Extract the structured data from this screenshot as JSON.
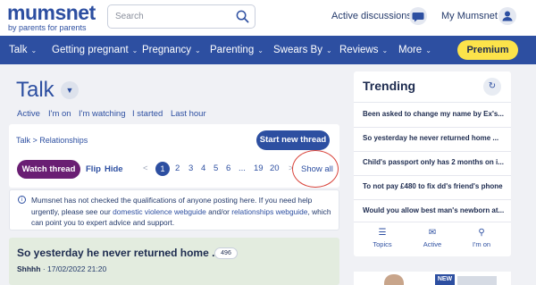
{
  "header": {
    "logo_main": "mumsnet",
    "logo_tagline": "by parents for parents",
    "search_placeholder": "Search",
    "active_discussions": "Active discussions",
    "my_mumsnet": "My Mumsnet"
  },
  "nav": {
    "items": [
      {
        "label": "Talk"
      },
      {
        "label": "Getting pregnant"
      },
      {
        "label": "Pregnancy"
      },
      {
        "label": "Parenting"
      },
      {
        "label": "Swears By"
      },
      {
        "label": "Reviews"
      },
      {
        "label": "More"
      }
    ],
    "premium": "Premium"
  },
  "talk": {
    "title": "Talk",
    "subnav": [
      "Active",
      "I'm on",
      "I'm watching",
      "I started",
      "Last hour"
    ]
  },
  "breadcrumb": "Talk > Relationships",
  "toolbar": {
    "new_thread": "Start new thread",
    "watch": "Watch thread",
    "flip": "Flip",
    "hide": "Hide",
    "prev": "<",
    "next": ">",
    "pages": [
      "1",
      "2",
      "3",
      "4",
      "5",
      "6",
      "...",
      "19",
      "20"
    ],
    "show_all": "Show all"
  },
  "info": {
    "text_1": "Mumsnet has not checked the qualifications of anyone posting here. If you need help urgently, please see our ",
    "link_1": "domestic violence webguide",
    "text_2": " and/or ",
    "link_2": "relationships webguide",
    "text_3": ", which can point you to expert advice and support."
  },
  "thread": {
    "title": "So yesterday he never returned home ...",
    "count": "496",
    "author": "Shhhh",
    "date": "17/02/2022 21:20"
  },
  "trending": {
    "title": "Trending",
    "items": [
      "Been asked to change my name by Ex's...",
      "So yesterday he never returned home ...",
      "Child's passport only has 2 months on i...",
      "To not pay £480 to fix dd's friend's phone",
      "Would you allow best man's newborn at..."
    ],
    "tabs": [
      {
        "label": "Topics",
        "icon": "list-icon"
      },
      {
        "label": "Active",
        "icon": "chat-icon"
      },
      {
        "label": "I'm on",
        "icon": "pin-icon"
      }
    ]
  },
  "ad": {
    "badge": "NEW"
  },
  "colors": {
    "brand": "#2d4fa1",
    "premium": "#fce34a",
    "watch": "#6a1e73",
    "highlight": "#d9433a"
  }
}
